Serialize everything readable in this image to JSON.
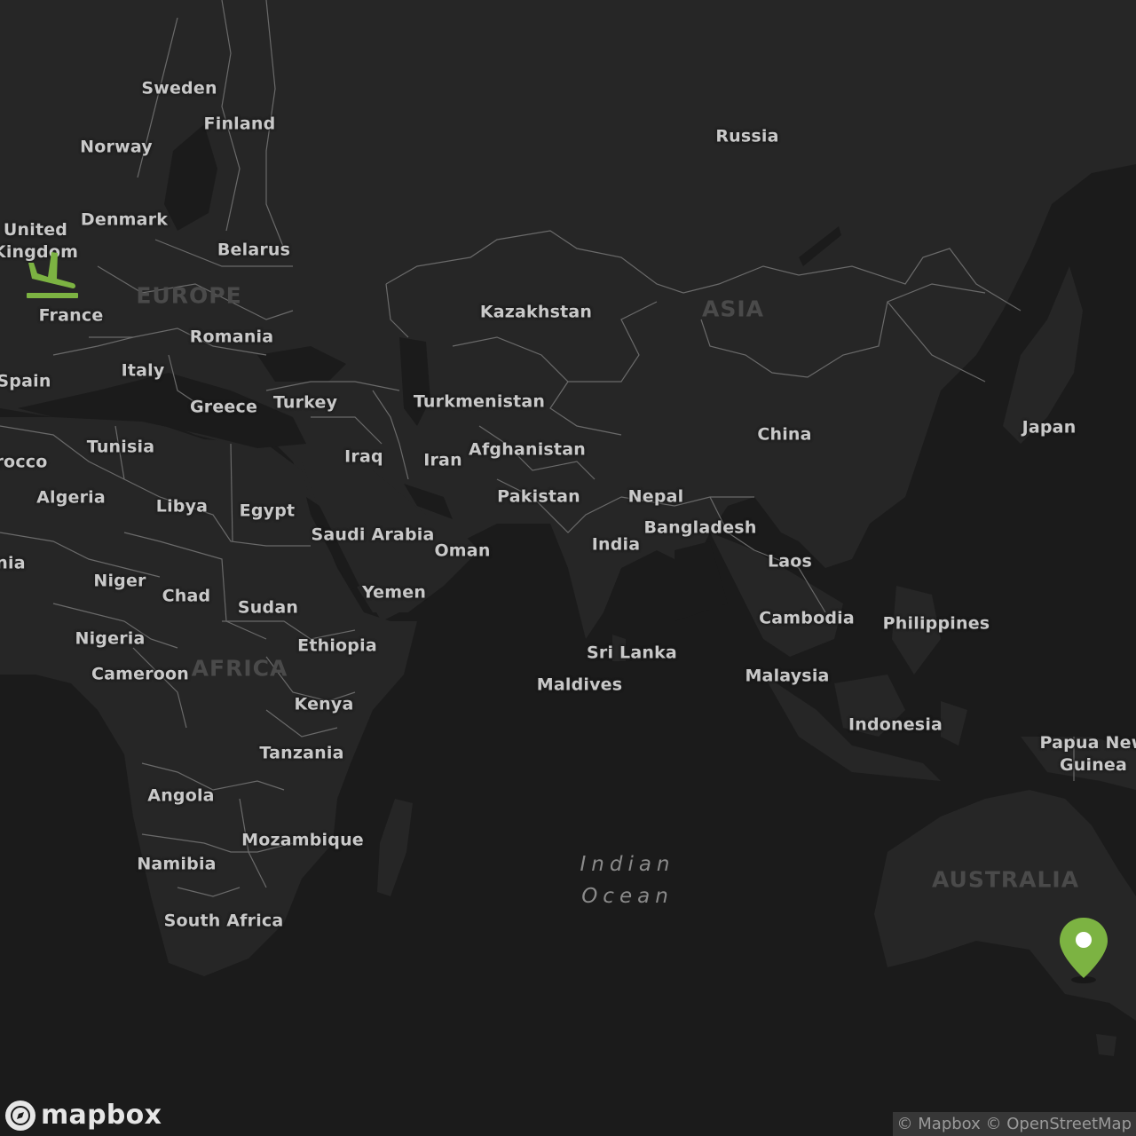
{
  "map": {
    "countries": [
      {
        "id": "sweden",
        "name": "Sweden"
      },
      {
        "id": "finland",
        "name": "Finland"
      },
      {
        "id": "norway",
        "name": "Norway"
      },
      {
        "id": "russia",
        "name": "Russia"
      },
      {
        "id": "denmark",
        "name": "Denmark"
      },
      {
        "id": "uk",
        "name": "United\nKingdom"
      },
      {
        "id": "belarus",
        "name": "Belarus"
      },
      {
        "id": "france",
        "name": "France"
      },
      {
        "id": "romania",
        "name": "Romania"
      },
      {
        "id": "kazakhstan",
        "name": "Kazakhstan"
      },
      {
        "id": "italy",
        "name": "Italy"
      },
      {
        "id": "spain",
        "name": "Spain"
      },
      {
        "id": "greece",
        "name": "Greece"
      },
      {
        "id": "turkey",
        "name": "Turkey"
      },
      {
        "id": "turkmenistan",
        "name": "Turkmenistan"
      },
      {
        "id": "china",
        "name": "China"
      },
      {
        "id": "japan",
        "name": "Japan"
      },
      {
        "id": "morocco",
        "name": "rocco"
      },
      {
        "id": "tunisia",
        "name": "Tunisia"
      },
      {
        "id": "iraq",
        "name": "Iraq"
      },
      {
        "id": "iran",
        "name": "Iran"
      },
      {
        "id": "afghanistan",
        "name": "Afghanistan"
      },
      {
        "id": "algeria",
        "name": "Algeria"
      },
      {
        "id": "libya",
        "name": "Libya"
      },
      {
        "id": "egypt",
        "name": "Egypt"
      },
      {
        "id": "pakistan",
        "name": "Pakistan"
      },
      {
        "id": "nepal",
        "name": "Nepal"
      },
      {
        "id": "saudi",
        "name": "Saudi Arabia"
      },
      {
        "id": "bangladesh",
        "name": "Bangladesh"
      },
      {
        "id": "india",
        "name": "India"
      },
      {
        "id": "oman",
        "name": "Oman"
      },
      {
        "id": "mauritania",
        "name": "nia"
      },
      {
        "id": "laos",
        "name": "Laos"
      },
      {
        "id": "niger",
        "name": "Niger"
      },
      {
        "id": "chad",
        "name": "Chad"
      },
      {
        "id": "yemen",
        "name": "Yemen"
      },
      {
        "id": "sudan",
        "name": "Sudan"
      },
      {
        "id": "cambodia",
        "name": "Cambodia"
      },
      {
        "id": "philippines",
        "name": "Philippines"
      },
      {
        "id": "nigeria",
        "name": "Nigeria"
      },
      {
        "id": "ethiopia",
        "name": "Ethiopia"
      },
      {
        "id": "srilanka",
        "name": "Sri Lanka"
      },
      {
        "id": "cameroon",
        "name": "Cameroon"
      },
      {
        "id": "malaysia",
        "name": "Malaysia"
      },
      {
        "id": "maldives",
        "name": "Maldives"
      },
      {
        "id": "kenya",
        "name": "Kenya"
      },
      {
        "id": "indonesia",
        "name": "Indonesia"
      },
      {
        "id": "png",
        "name": "Papua New\nGuinea"
      },
      {
        "id": "tanzania",
        "name": "Tanzania"
      },
      {
        "id": "angola",
        "name": "Angola"
      },
      {
        "id": "mozambique",
        "name": "Mozambique"
      },
      {
        "id": "namibia",
        "name": "Namibia"
      },
      {
        "id": "southafrica",
        "name": "South Africa"
      }
    ],
    "continents": [
      {
        "id": "europe",
        "name": "EUROPE"
      },
      {
        "id": "asia",
        "name": "ASIA"
      },
      {
        "id": "africa",
        "name": "AFRICA"
      },
      {
        "id": "australia",
        "name": "AUSTRALIA"
      }
    ],
    "oceans": [
      {
        "id": "indian",
        "name": "Indian\nOcean"
      }
    ]
  },
  "markers": {
    "origin_icon": "airplane-landing-icon",
    "destination_icon": "map-pin-icon",
    "accent_color": "#7cb342"
  },
  "branding": {
    "logo_text": "mapbox"
  },
  "attribution": {
    "mapbox": "© Mapbox",
    "osm": "© OpenStreetMap"
  },
  "colors": {
    "water": "#1b1b1b",
    "land": "#262626",
    "borders": "#6a6a6a",
    "labels": "#c9c9c9"
  }
}
